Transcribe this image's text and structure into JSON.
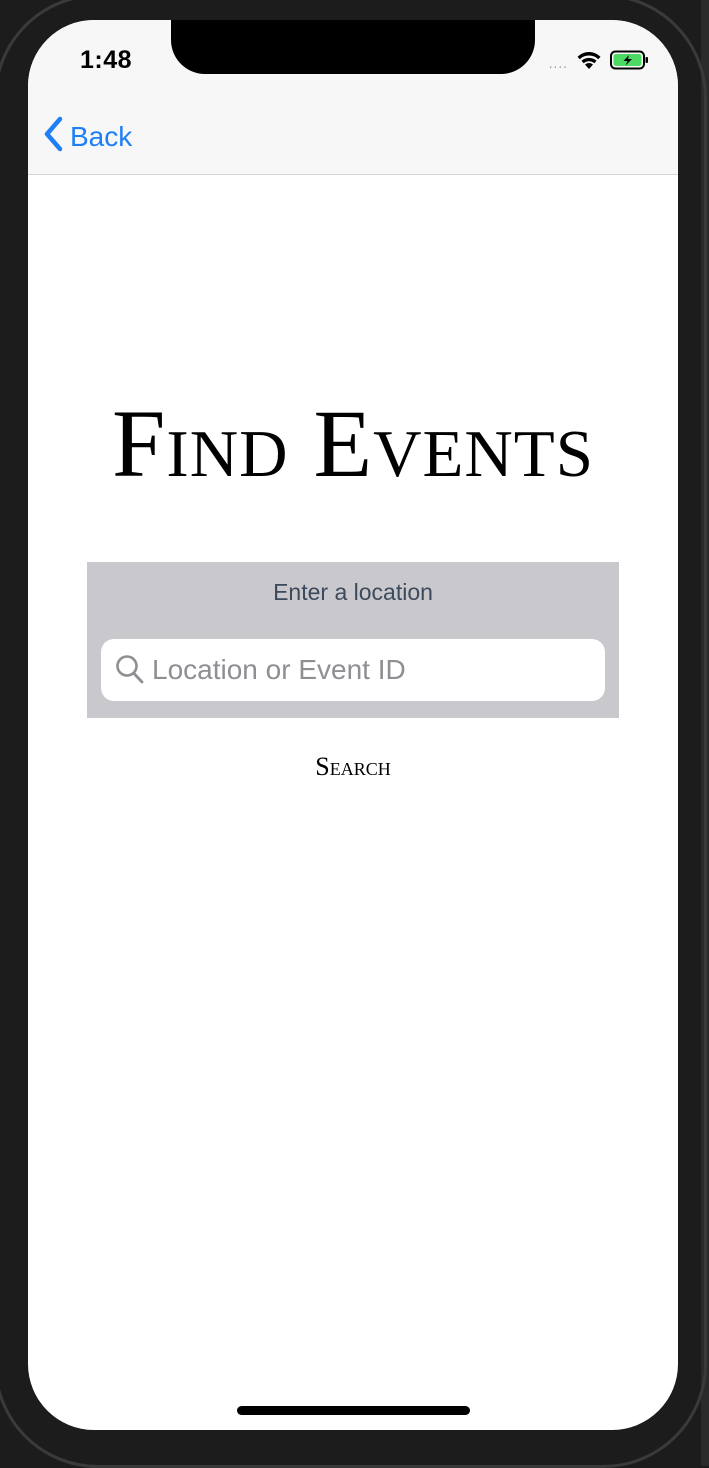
{
  "status_bar": {
    "time": "1:48",
    "signal_dots": "....",
    "icons": [
      "wifi-icon",
      "battery-charging-icon"
    ],
    "battery_color": "#4cd964"
  },
  "nav": {
    "back_label": "Back",
    "back_icon": "chevron-left-icon",
    "accent_color": "#1f7ff5"
  },
  "main": {
    "title": "Find Events",
    "search_panel": {
      "label": "Enter a location",
      "placeholder": "Location or Event ID",
      "value": "",
      "icon": "search-icon"
    },
    "search_button_label": "Search"
  }
}
